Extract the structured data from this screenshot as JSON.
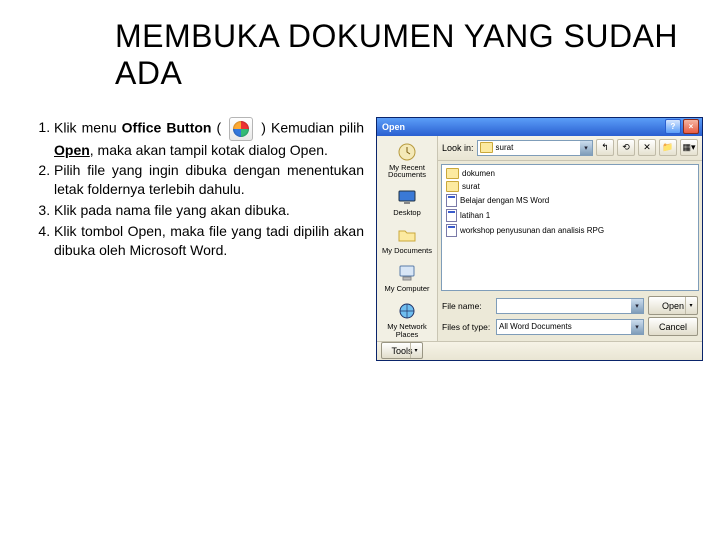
{
  "title": "MEMBUKA DOKUMEN YANG SUDAH ADA",
  "steps": {
    "s1a": "Klik menu ",
    "s1b": "Office Button",
    "s1c": " ( ",
    "s1d": " ) Kemudian pilih ",
    "s1e": "Open",
    "s1f": ", maka akan tampil kotak dialog Open.",
    "s2": "Pilih file yang ingin dibuka dengan menentukan letak foldernya terlebih dahulu.",
    "s3": "Klik pada nama file yang akan dibuka.",
    "s4": "Klik tombol Open, maka file yang tadi dipilih akan dibuka oleh Microsoft Word."
  },
  "dialog": {
    "title": "Open",
    "lookin_label": "Look in:",
    "lookin_value": "surat",
    "places": {
      "recent": "My Recent Documents",
      "desktop": "Desktop",
      "mydocs": "My Documents",
      "mycomp": "My Computer",
      "mynet": "My Network Places"
    },
    "files": [
      {
        "type": "folder",
        "name": "dokumen"
      },
      {
        "type": "folder",
        "name": "surat"
      },
      {
        "type": "doc",
        "name": "Belajar dengan MS Word"
      },
      {
        "type": "doc",
        "name": "latihan 1"
      },
      {
        "type": "doc",
        "name": "workshop penyusunan dan analisis RPG"
      }
    ],
    "filename_label": "File name:",
    "filename_value": "",
    "filetype_label": "Files of type:",
    "filetype_value": "All Word Documents",
    "open_btn": "Open",
    "cancel_btn": "Cancel",
    "tools_btn": "Tools"
  }
}
